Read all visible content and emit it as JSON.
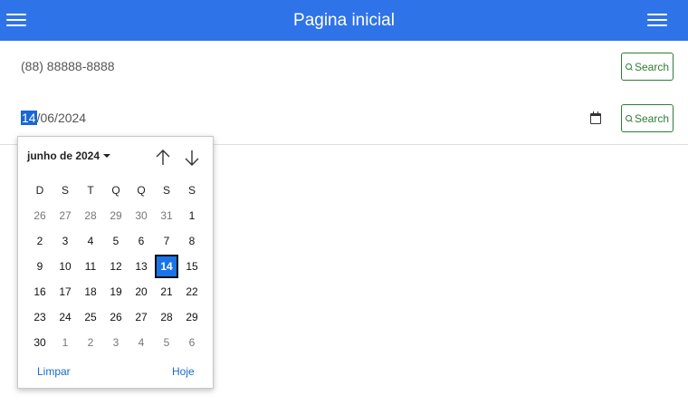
{
  "header": {
    "title": "Pagina inicial"
  },
  "phone_field": {
    "value": "(88) 88888-8888"
  },
  "date_field": {
    "day": "14",
    "sep1": "/",
    "month": "06",
    "sep2": "/",
    "year": "2024"
  },
  "search_button": {
    "label": "Search"
  },
  "calendar": {
    "month_label": "junho de 2024",
    "weekdays": [
      "D",
      "S",
      "T",
      "Q",
      "Q",
      "S",
      "S"
    ],
    "weeks": [
      [
        "26",
        "27",
        "28",
        "29",
        "30",
        "31",
        "1"
      ],
      [
        "2",
        "3",
        "4",
        "5",
        "6",
        "7",
        "8"
      ],
      [
        "9",
        "10",
        "11",
        "12",
        "13",
        "14",
        "15"
      ],
      [
        "16",
        "17",
        "18",
        "19",
        "20",
        "21",
        "22"
      ],
      [
        "23",
        "24",
        "25",
        "26",
        "27",
        "28",
        "29"
      ],
      [
        "30",
        "1",
        "2",
        "3",
        "4",
        "5",
        "6"
      ]
    ],
    "selected_day": "14",
    "clear_label": "Limpar",
    "today_label": "Hoje"
  },
  "colors": {
    "header": "#2f73e8",
    "selected": "#1a73e8",
    "search_border": "#2e7d32",
    "link": "#1a6ad0"
  },
  "icons": {
    "menu": "menu-icon",
    "calendar": "calendar-icon",
    "search": "search-icon",
    "up": "arrow-up-icon",
    "down": "arrow-down-icon"
  }
}
